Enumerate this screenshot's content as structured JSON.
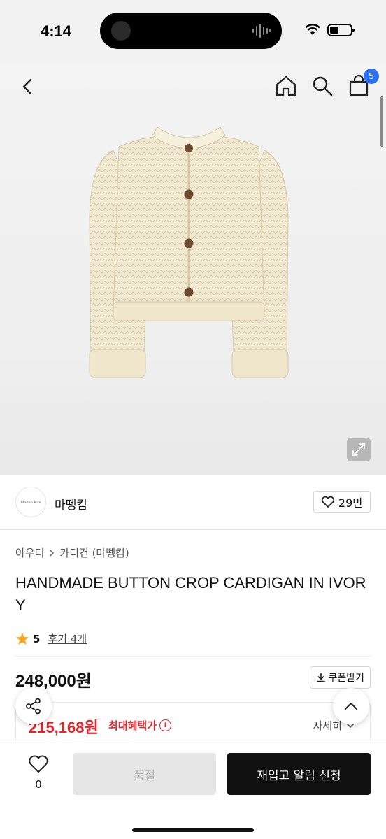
{
  "status_bar": {
    "time": "4:14"
  },
  "header": {
    "cart_count": "5"
  },
  "brand": {
    "logo_text": "Madan Kim",
    "name": "마뗑킴",
    "likes": "29만"
  },
  "breadcrumb": {
    "category": "아우터",
    "subcategory": "카디건 (마뗑킴)"
  },
  "product": {
    "title": "HANDMADE BUTTON CROP CARDIGAN IN IVORY",
    "rating": "5",
    "reviews": "후기 4개",
    "price": "248,000원",
    "coupon_label": "쿠폰받기",
    "benefit_price": "215,168원",
    "benefit_label": "최대혜택가",
    "detail_label": "자세히"
  },
  "bottom_bar": {
    "wish_count": "0",
    "soldout_label": "품절",
    "restock_label": "재입고 알림 신청"
  },
  "colors": {
    "accent_blue": "#2b6ff6",
    "benefit_red": "#e5242b",
    "star": "#f5a623"
  }
}
